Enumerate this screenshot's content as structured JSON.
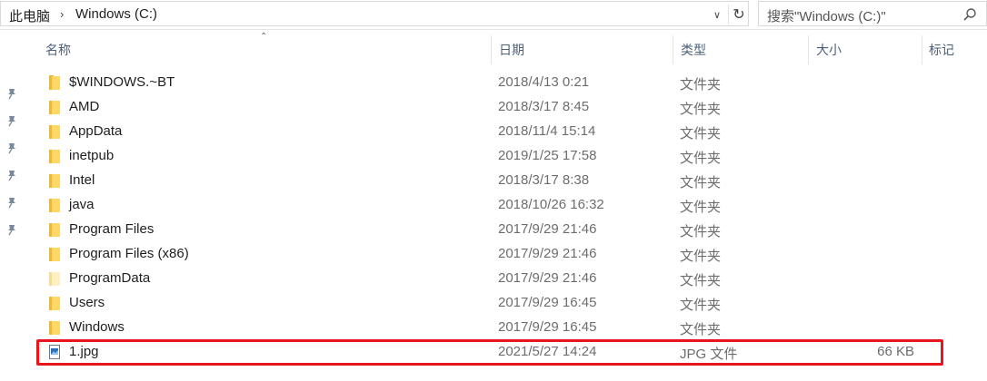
{
  "address": {
    "crumbs": [
      "此电脑",
      "Windows (C:)"
    ]
  },
  "search": {
    "placeholder": "搜索\"Windows (C:)\""
  },
  "columns": {
    "name": "名称",
    "date": "日期",
    "type": "类型",
    "size": "大小",
    "tags": "标记"
  },
  "files": [
    {
      "name": "$WINDOWS.~BT",
      "date": "2018/4/13 0:21",
      "type": "文件夹",
      "size": "",
      "icon": "folder-icon"
    },
    {
      "name": "AMD",
      "date": "2018/3/17 8:45",
      "type": "文件夹",
      "size": "",
      "icon": "folder-icon"
    },
    {
      "name": "AppData",
      "date": "2018/11/4 15:14",
      "type": "文件夹",
      "size": "",
      "icon": "folder-icon"
    },
    {
      "name": "inetpub",
      "date": "2019/1/25 17:58",
      "type": "文件夹",
      "size": "",
      "icon": "folder-icon"
    },
    {
      "name": "Intel",
      "date": "2018/3/17 8:38",
      "type": "文件夹",
      "size": "",
      "icon": "folder-icon"
    },
    {
      "name": "java",
      "date": "2018/10/26 16:32",
      "type": "文件夹",
      "size": "",
      "icon": "folder-icon"
    },
    {
      "name": "Program Files",
      "date": "2017/9/29 21:46",
      "type": "文件夹",
      "size": "",
      "icon": "folder-icon"
    },
    {
      "name": "Program Files (x86)",
      "date": "2017/9/29 21:46",
      "type": "文件夹",
      "size": "",
      "icon": "folder-icon"
    },
    {
      "name": "ProgramData",
      "date": "2017/9/29 21:46",
      "type": "文件夹",
      "size": "",
      "icon": "folder-icon"
    },
    {
      "name": "Users",
      "date": "2017/9/29 16:45",
      "type": "文件夹",
      "size": "",
      "icon": "folder-icon"
    },
    {
      "name": "Windows",
      "date": "2017/9/29 16:45",
      "type": "文件夹",
      "size": "",
      "icon": "folder-icon"
    },
    {
      "name": "1.jpg",
      "date": "2021/5/27 14:24",
      "type": "JPG 文件",
      "size": "66 KB",
      "icon": "image-file-icon"
    }
  ],
  "colors": {
    "folder": "#ffd766",
    "highlight_border": "#e8151e",
    "header_text": "#4c607a"
  }
}
